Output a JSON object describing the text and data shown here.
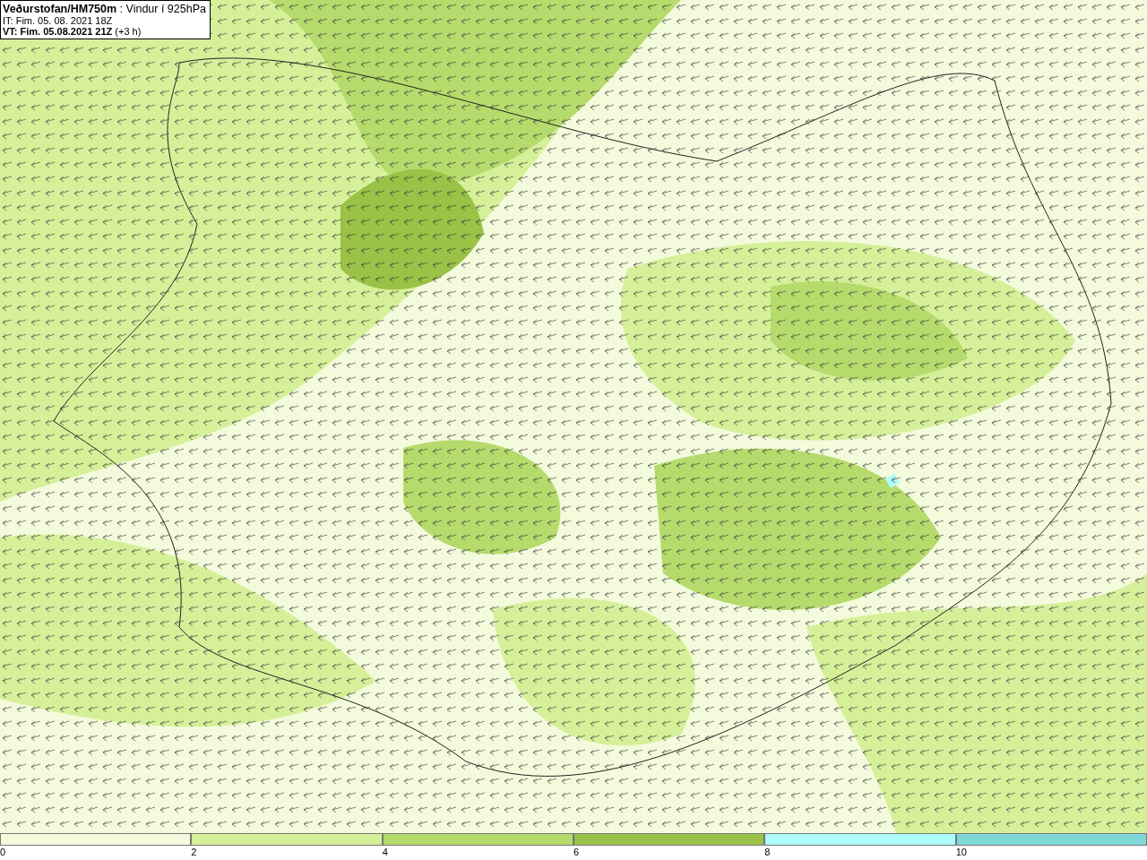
{
  "header": {
    "lines": [
      "**Veðurstofan/HM750m** : Vindur í 925hPa",
      "IT: Fim. 05. 08. 2021 18Z",
      "**VT: Fim. 05.08.2021 21Z** (+3 h)"
    ]
  },
  "legend": {
    "bins": [
      {
        "label": "0",
        "color": "#f4fbdc"
      },
      {
        "label": "2",
        "color": "#d6f09a"
      },
      {
        "label": "4",
        "color": "#b5db6c"
      },
      {
        "label": "6",
        "color": "#99c246"
      },
      {
        "label": "8",
        "color": "#acfcfa"
      },
      {
        "label": "10",
        "color": "#7fd8d8"
      }
    ]
  }
}
